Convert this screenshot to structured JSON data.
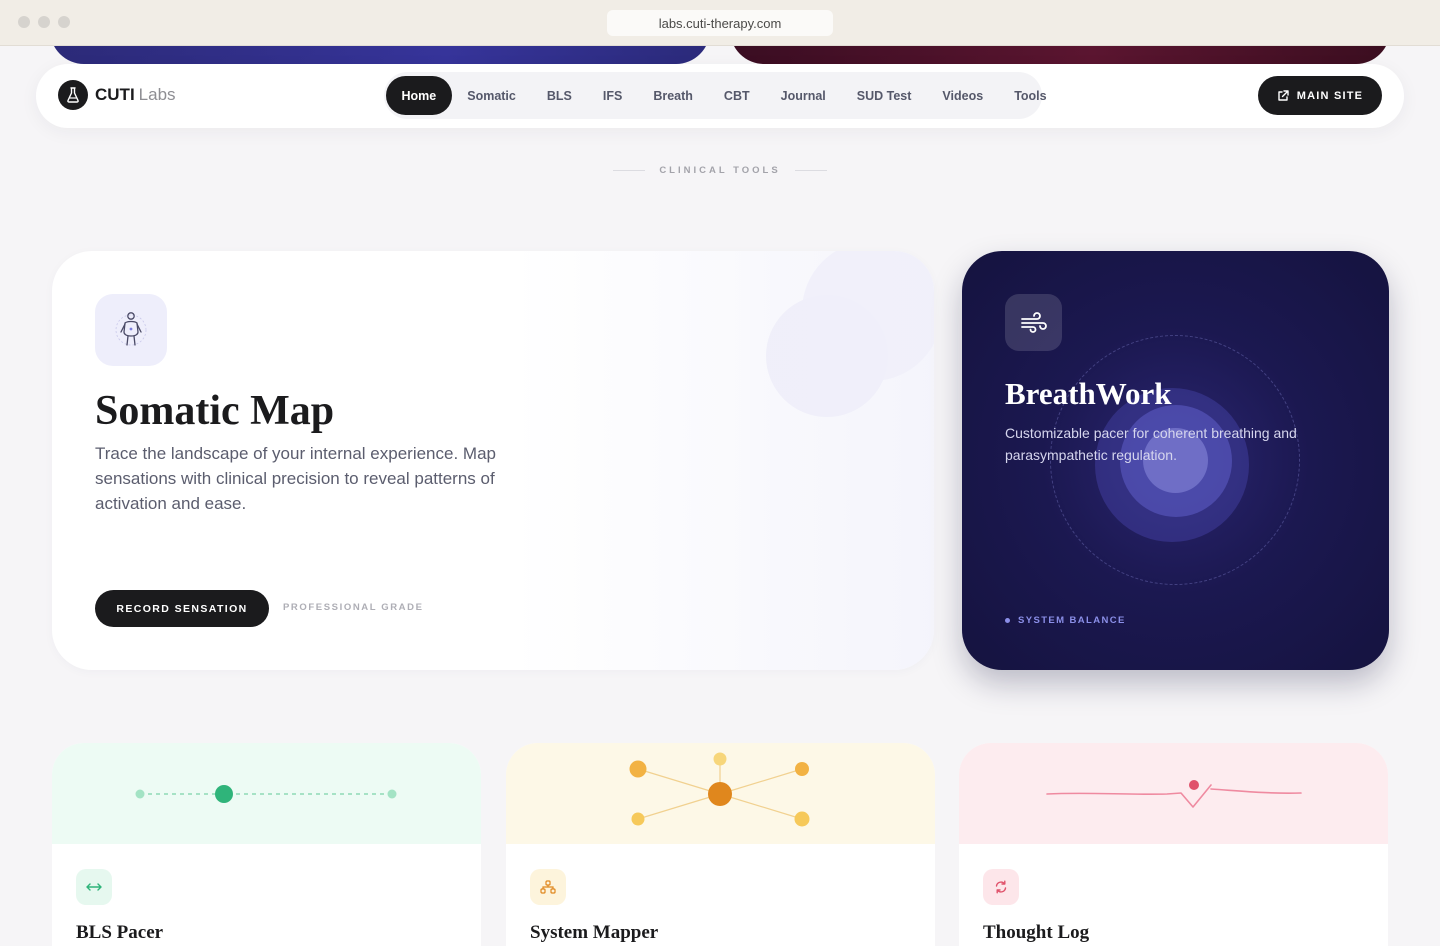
{
  "browser": {
    "url": "labs.cuti-therapy.com"
  },
  "brand": {
    "name": "CUTI",
    "sub": "Labs"
  },
  "nav": {
    "items": [
      "Home",
      "Somatic",
      "BLS",
      "IFS",
      "Breath",
      "CBT",
      "Journal",
      "SUD Test",
      "Videos",
      "Tools"
    ],
    "active": "Home",
    "main_site_label": "MAIN SITE"
  },
  "section": {
    "label": "CLINICAL TOOLS"
  },
  "somatic": {
    "icon": "body-figure-icon",
    "title": "Somatic Map",
    "description": "Trace the landscape of your internal experience. Map sensations with clinical precision to reveal patterns of activation and ease.",
    "button_label": "RECORD SENSATION",
    "tag": "PROFESSIONAL GRADE"
  },
  "breathwork": {
    "icon": "wind-icon",
    "title": "BreathWork",
    "description": "Customizable pacer for coherent breathing and parasympathetic regulation.",
    "tag": "SYSTEM BALANCE",
    "accent": "#8b8fe8"
  },
  "tools": [
    {
      "name": "BLS Pacer",
      "icon": "arrows-horizontal-icon",
      "color": "#2fb47a"
    },
    {
      "name": "System Mapper",
      "icon": "network-icon",
      "color": "#e0871d"
    },
    {
      "name": "Thought Log",
      "icon": "refresh-icon",
      "color": "#e0526b"
    }
  ]
}
